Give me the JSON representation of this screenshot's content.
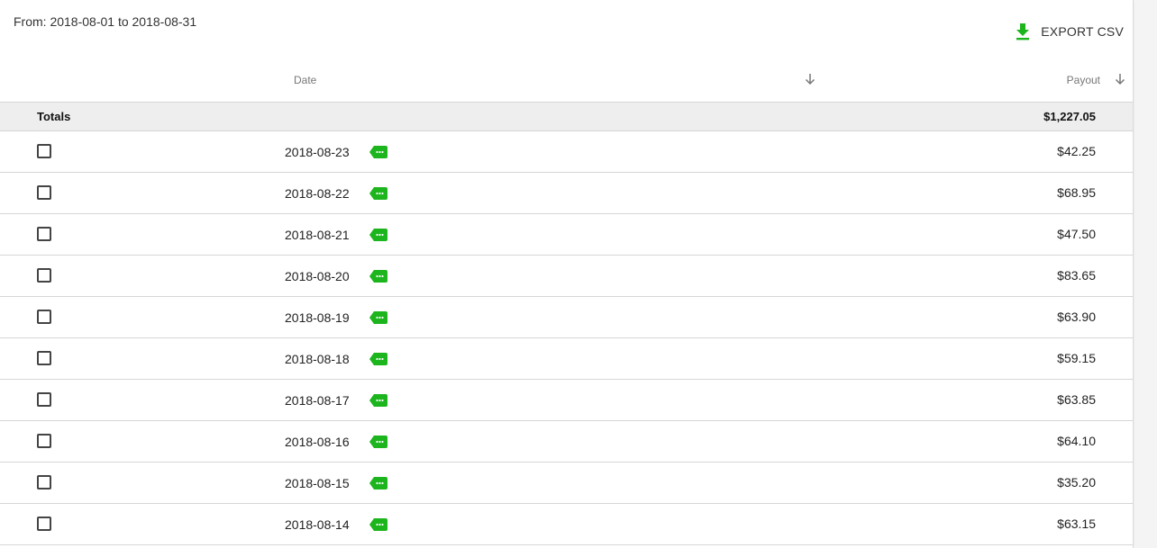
{
  "range_label": "From: 2018-08-01 to 2018-08-31",
  "export": {
    "label": "EXPORT CSV",
    "icon": "download-icon"
  },
  "columns": {
    "date": "Date",
    "payout": "Payout"
  },
  "totals": {
    "label": "Totals",
    "value": "$1,227.05"
  },
  "rows": [
    {
      "date": "2018-08-23",
      "payout": "$42.25"
    },
    {
      "date": "2018-08-22",
      "payout": "$68.95"
    },
    {
      "date": "2018-08-21",
      "payout": "$47.50"
    },
    {
      "date": "2018-08-20",
      "payout": "$83.65"
    },
    {
      "date": "2018-08-19",
      "payout": "$63.90"
    },
    {
      "date": "2018-08-18",
      "payout": "$59.15"
    },
    {
      "date": "2018-08-17",
      "payout": "$63.85"
    },
    {
      "date": "2018-08-16",
      "payout": "$64.10"
    },
    {
      "date": "2018-08-15",
      "payout": "$35.20"
    },
    {
      "date": "2018-08-14",
      "payout": "$63.15"
    }
  ],
  "colors": {
    "accent_green": "#1db51d",
    "totals_bg": "#eeeeee",
    "divider": "#d6d6d6"
  }
}
